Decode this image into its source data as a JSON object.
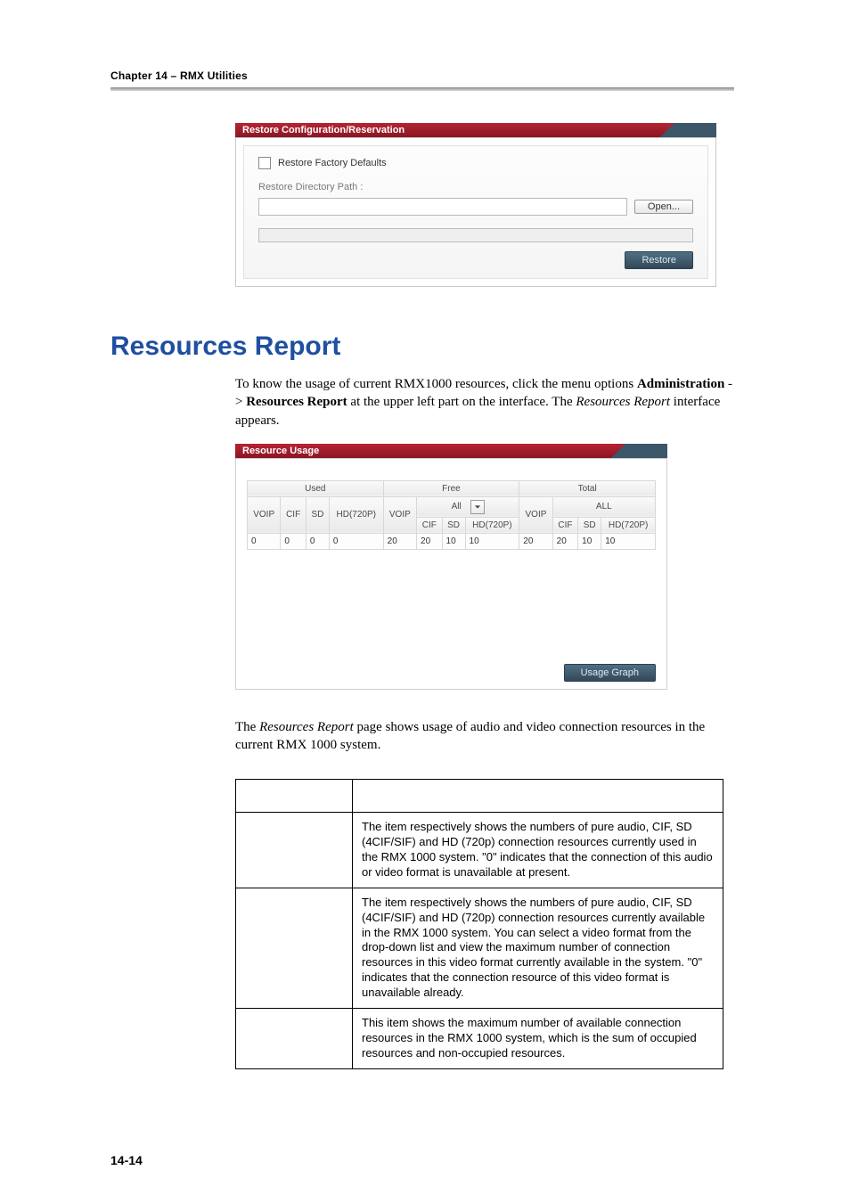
{
  "header": {
    "chapter": "Chapter 14 – RMX Utilities"
  },
  "dialog1": {
    "title": "Restore Configuration/Reservation",
    "restoreFactory": "Restore Factory Defaults",
    "restoreDirPath": "Restore Directory Path :",
    "open": "Open...",
    "restore": "Restore"
  },
  "heading": "Resources Report",
  "para1": {
    "t1": "To know the usage of current RMX1000 resources, click the menu options ",
    "b1": "Administration",
    "t2": " -> ",
    "b2": "Resources Report",
    "t3": " at the upper left part on the interface. The ",
    "i1": "Resources Report",
    "t4": " interface appears."
  },
  "dialog2": {
    "title": "Resource Usage",
    "groups": {
      "used": "Used",
      "free": "Free",
      "total": "Total"
    },
    "freeAll": "All",
    "totalAll": "ALL",
    "headers": {
      "voip": "VOIP",
      "cif": "CIF",
      "sd": "SD",
      "hd": "HD(720P)"
    },
    "row": {
      "used": {
        "voip": "0",
        "cif": "0",
        "sd": "0",
        "hd": "0"
      },
      "free": {
        "voip": "20",
        "cif": "20",
        "sd": "10",
        "hd": "10"
      },
      "total": {
        "voip": "20",
        "cif": "20",
        "sd": "10",
        "hd": "10"
      }
    },
    "usageGraph": "Usage Graph"
  },
  "para2": {
    "t1a": "The ",
    "i1": "Resources Report",
    "t1b": " page shows usage of audio and video connection resources in the current RMX 1000 system."
  },
  "definitions": [
    {
      "key": "",
      "value": "The item respectively shows the numbers of pure audio, CIF, SD (4CIF/SIF) and HD (720p) connection resources currently used in the RMX 1000 system. \"0\" indicates that the connection of this audio or video format is unavailable at present."
    },
    {
      "key": "",
      "value": "The item respectively shows the numbers of pure audio, CIF, SD (4CIF/SIF) and HD (720p) connection resources currently available in the RMX 1000 system. You can select a video format from the drop-down list and view the maximum number of connection resources in this video format currently available in the system. \"0\" indicates that the connection resource of this video format is unavailable already."
    },
    {
      "key": "",
      "value": "This item shows the maximum number of available connection resources in the RMX 1000 system, which is the sum of occupied resources and non-occupied resources."
    }
  ],
  "pageNumber": "14-14",
  "chart_data": {
    "type": "table",
    "title": "Resource Usage",
    "columns": {
      "Used": [
        "VOIP",
        "CIF",
        "SD",
        "HD(720P)"
      ],
      "Free": [
        "VOIP",
        "CIF",
        "SD",
        "HD(720P)"
      ],
      "Total": [
        "VOIP",
        "CIF",
        "SD",
        "HD(720P)"
      ]
    },
    "rows": [
      {
        "Used": [
          0,
          0,
          0,
          0
        ],
        "Free": [
          20,
          20,
          10,
          10
        ],
        "Total": [
          20,
          20,
          10,
          10
        ]
      }
    ]
  }
}
